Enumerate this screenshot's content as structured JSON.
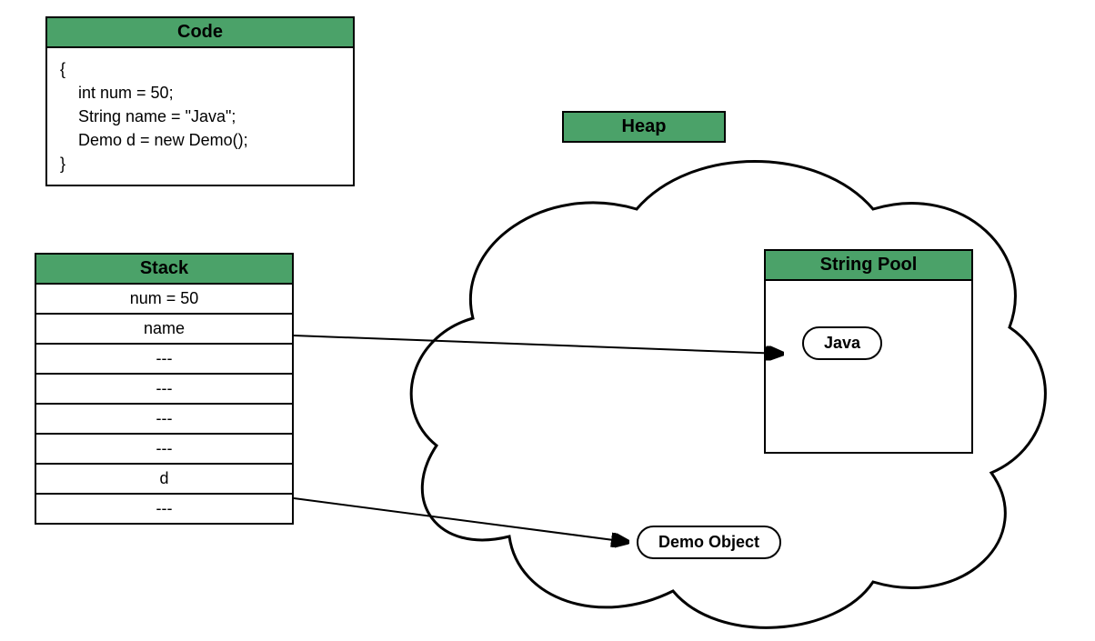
{
  "code": {
    "title": "Code",
    "body": "{\n    int num = 50;\n    String name = \"Java\";\n    Demo d = new Demo();\n}"
  },
  "stack": {
    "title": "Stack",
    "rows": [
      "num = 50",
      "name",
      "---",
      "---",
      "---",
      "---",
      "d",
      "---"
    ]
  },
  "heap": {
    "title": "Heap",
    "string_pool": {
      "title": "String Pool",
      "value": "Java"
    },
    "demo_object": "Demo Object"
  }
}
